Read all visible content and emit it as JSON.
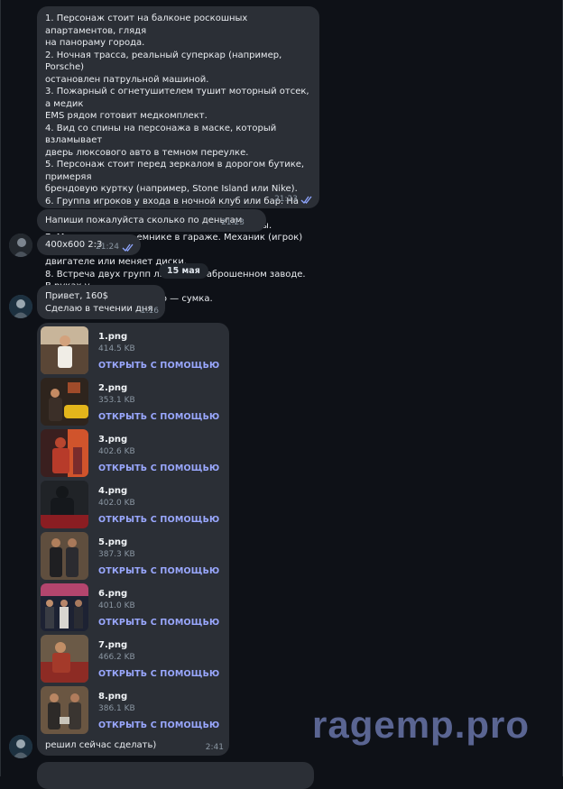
{
  "messages": [
    {
      "text": "1. Персонаж стоит на балконе роскошных апартаментов, глядя\nна панораму города.\n2. Ночная трасса, реальный суперкар (например, Porsche)\nостановлен патрульной машиной.\n3. Пожарный с огнетушителем тушит моторный отсек, а медик\nEMS рядом готовит медкомплект.\n4. Вид со спины на персонажа в маске, который взламывает\nдверь люксового авто в темном переулке.\n5. Персонаж стоит перед зеркалом в дорогом бутике, примеряя\nбрендовую куртку (например, Stone Island или Nike).\n6. Группа игроков у входа в ночной клуб или бар. На фоне —\nнеоновые вывески и припаркованные машины.\n7. Машина на подъемнике в гараже. Механик (игрок) копается в\nдвигателе или меняет диски.\n8. Встреча двух групп людей на заброшенном заводе. В руках у\nодного — кейс, у другого — сумка.",
      "time": "21:23"
    },
    {
      "text": "Напиши пожалуйста сколько по деньгам",
      "time": "21:23"
    },
    {
      "text": "400x600 2:3",
      "time": "21:24"
    },
    {
      "text": "Привет, 160$\nСделаю в течении дня",
      "time": "1:16"
    },
    {
      "text": "решил сейчас сделать)",
      "time": "2:41"
    }
  ],
  "date_separator": "15 мая",
  "files": [
    {
      "name": "1.png",
      "size": "414.5 KB",
      "action": "ОТКРЫТЬ С ПОМОЩЬЮ"
    },
    {
      "name": "2.png",
      "size": "353.1 KB",
      "action": "ОТКРЫТЬ С ПОМОЩЬЮ"
    },
    {
      "name": "3.png",
      "size": "402.6 KB",
      "action": "ОТКРЫТЬ С ПОМОЩЬЮ"
    },
    {
      "name": "4.png",
      "size": "402.0 KB",
      "action": "ОТКРЫТЬ С ПОМОЩЬЮ"
    },
    {
      "name": "5.png",
      "size": "387.3 KB",
      "action": "ОТКРЫТЬ С ПОМОЩЬЮ"
    },
    {
      "name": "6.png",
      "size": "401.0 KB",
      "action": "ОТКРЫТЬ С ПОМОЩЬЮ"
    },
    {
      "name": "7.png",
      "size": "466.2 KB",
      "action": "ОТКРЫТЬ С ПОМОЩЬЮ"
    },
    {
      "name": "8.png",
      "size": "386.1 KB",
      "action": "ОТКРЫТЬ С ПОМОЩЬЮ"
    }
  ],
  "watermark": "ragemp.pro",
  "colors": {
    "background": "#0e1117",
    "bubble": "#2b2f36",
    "accent_link": "#9aa8ff",
    "read_check": "#8fa6ff",
    "meta_text": "#8b97a3"
  },
  "icons": {
    "read_receipt": "double-check-icon",
    "avatar": "avatar"
  }
}
